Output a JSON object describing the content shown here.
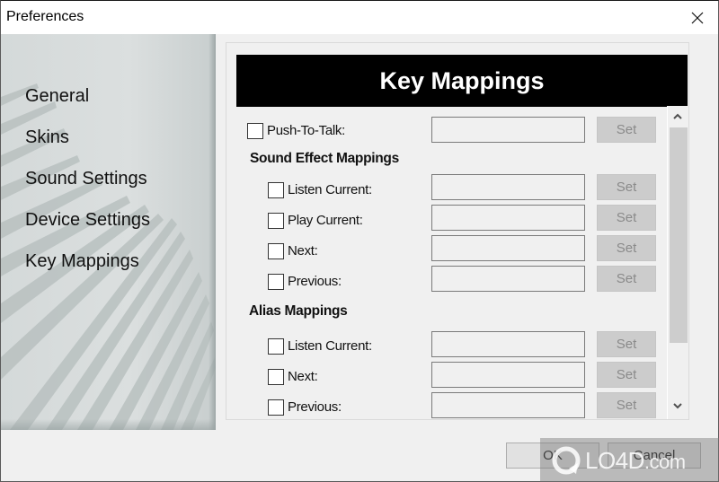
{
  "window": {
    "title": "Preferences",
    "close_icon": "close-x-icon"
  },
  "sidebar": {
    "items": [
      {
        "label": "General"
      },
      {
        "label": "Skins"
      },
      {
        "label": "Sound Settings"
      },
      {
        "label": "Device Settings"
      },
      {
        "label": "Key Mappings"
      }
    ]
  },
  "panel": {
    "header": "Key Mappings",
    "push_to_talk": {
      "label": "Push-To-Talk:",
      "checked": false,
      "value": "",
      "set_label": "Set"
    },
    "sound_effect": {
      "heading": "Sound Effect Mappings",
      "rows": [
        {
          "label": "Listen Current:",
          "checked": false,
          "value": "",
          "set_label": "Set"
        },
        {
          "label": "Play Current:",
          "checked": false,
          "value": "",
          "set_label": "Set"
        },
        {
          "label": "Next:",
          "checked": false,
          "value": "",
          "set_label": "Set"
        },
        {
          "label": "Previous:",
          "checked": false,
          "value": "",
          "set_label": "Set"
        }
      ]
    },
    "alias": {
      "heading": "Alias Mappings",
      "rows": [
        {
          "label": "Listen Current:",
          "checked": false,
          "value": "",
          "set_label": "Set"
        },
        {
          "label": "Next:",
          "checked": false,
          "value": "",
          "set_label": "Set"
        },
        {
          "label": "Previous:",
          "checked": false,
          "value": "",
          "set_label": "Set"
        }
      ]
    }
  },
  "footer": {
    "ok_label": "OK",
    "cancel_label": "Cancel"
  },
  "watermark": {
    "text": "LO4D",
    "suffix": ".com"
  },
  "colors": {
    "header_bg": "#000000",
    "header_fg": "#ffffff",
    "set_disabled_bg": "#cccccc",
    "set_disabled_fg": "#8a8a8a"
  }
}
